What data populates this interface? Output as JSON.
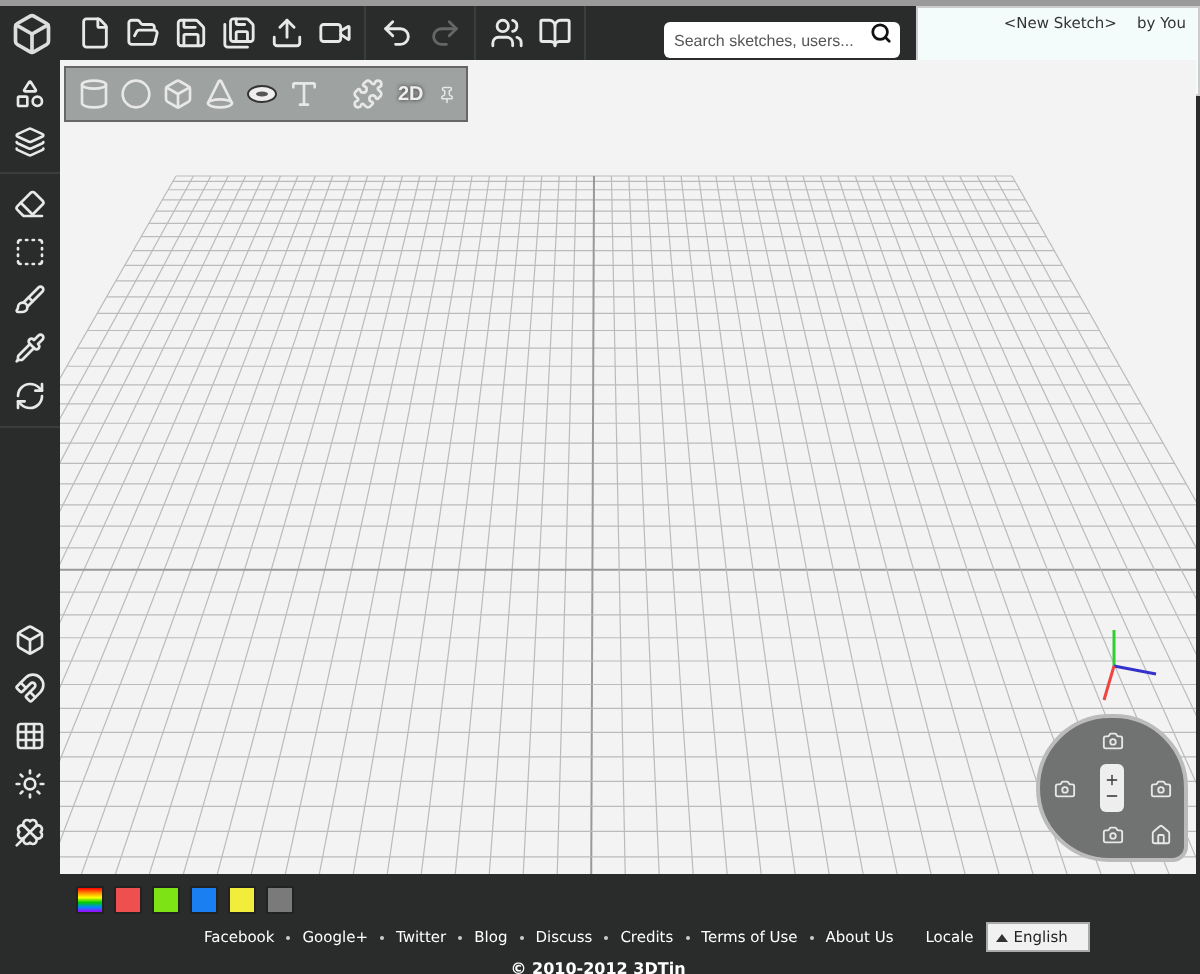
{
  "toolbar": {
    "search": {
      "placeholder": "Search sketches, users..."
    }
  },
  "sketch_info": {
    "title": "<New Sketch>",
    "author": "by You"
  },
  "shape_toolbar": {
    "mode_label": "2D"
  },
  "color_swatches": [
    {
      "kind": "rainbow"
    },
    {
      "kind": "solid",
      "color": "#ee4f4f"
    },
    {
      "kind": "solid",
      "color": "#7de314"
    },
    {
      "kind": "solid",
      "color": "#1a7ff0"
    },
    {
      "kind": "solid",
      "color": "#f2ec3a"
    },
    {
      "kind": "solid",
      "color": "#7a7a7a"
    }
  ],
  "footer": {
    "links": [
      "Facebook",
      "Google+",
      "Twitter",
      "Blog",
      "Discuss",
      "Credits",
      "Terms of Use",
      "About Us"
    ],
    "locale_label": "Locale",
    "locale_value": "English",
    "copyright": "© 2010-2012 3DTin"
  }
}
